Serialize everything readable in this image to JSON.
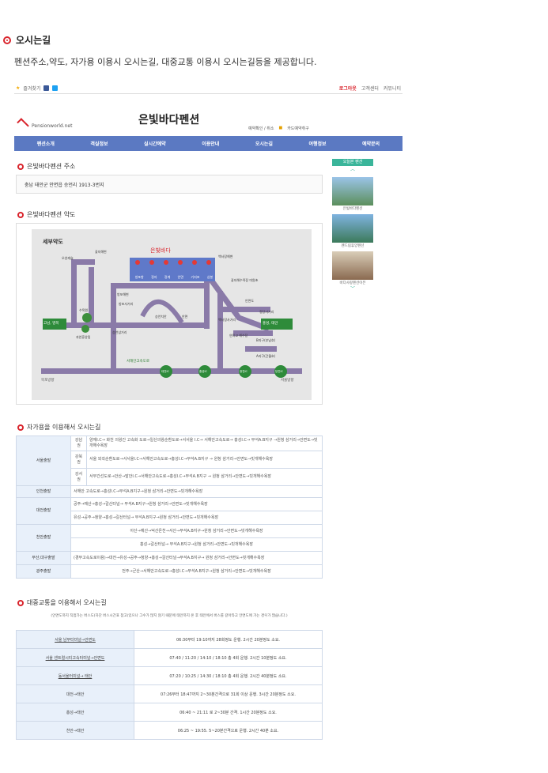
{
  "title": "오시는길",
  "desc": "펜션주소,약도, 자가용 이용시 오시는길, 대중교통 이용시 오시는길등을 제공합니다.",
  "topbar": {
    "fav": "즐겨찾기",
    "login": "로그아웃",
    "cs": "고객센터",
    "community": "커뮤니티"
  },
  "logo": "Pensionworld.net",
  "brand": "은빛바다펜션",
  "util": {
    "check": "예약확인 / 취소",
    "card": "카드예약취구"
  },
  "nav": [
    "펜션소개",
    "객실정보",
    "실시간예약",
    "이용안내",
    "오시는길",
    "여행정보",
    "예약문의"
  ],
  "sections": {
    "addr": "은빛바다펜션 주소",
    "map": "은빛바다펜션 약도",
    "car": "자가용을 이용해서 오시는길",
    "bus": "대중교통을 이용해서 오시는길"
  },
  "address": "충남 태안군 안면읍 승언리 1913-3번지",
  "map_labels": {
    "title": "세부약도",
    "pension": "은빛바다",
    "left": "고남, 영목",
    "right": "홍성, 태안",
    "highway": "서해안고속도로",
    "bottom_left": "목포방향",
    "bottom_right": "서울방향"
  },
  "map_places": [
    "오션캐슬",
    "꽃지해변",
    "방포해변",
    "백사장해변",
    "꽃지해수욕장 미원초",
    "방포사거리",
    "승언삼거리",
    "수목원",
    "자연휴양림",
    "승언치안",
    "안면도",
    "정당사거리",
    "백사장사거리",
    "연육교 해수장",
    "B지구(부남호)",
    "A지구(간월호)",
    "안면",
    "대천IC",
    "홍성IC",
    "광천IC",
    "당진IC"
  ],
  "map_rooms": [
    "방포항",
    "정자",
    "정계",
    "안면",
    "기지포",
    "삼봉"
  ],
  "side": {
    "hdr": "오늘본 펜션",
    "caps": [
      "은빛바다펜션",
      "펜드림휴양펜션",
      "바다사랑펜션이븐"
    ]
  },
  "car": [
    {
      "k": "서울출발",
      "k2": "강남권",
      "v": "양재I.C→ 화천 의왕간 고속화 도로→일산의왕순환도로→서서울 I.C→ 서해안고속도로→ 홍성I.C→ 부석A.B지구 →원청 삼거리→안면도→빗개해수욕장"
    },
    {
      "k": "",
      "k2": "강북권",
      "v": "서울 외곽순환도로→서서울I.C→서해안고속도로→홍성I.C→부석A.B지구 → 원청 삼거리→안면도→빗개해수욕장"
    },
    {
      "k": "",
      "k2": "강서권",
      "v": "서부간선도로→안산→발안I.C→서해안고속도로→홍성I.C→부석A.B지구 → 원청 삼거리→안면도→빗개해수욕장"
    },
    {
      "k": "인천출발",
      "k2": "",
      "v": "서해안 고속도로→홍성I.C→부석A.B지구→원청 삼거리→안면도→빗개해수욕장"
    },
    {
      "k": "대전출발",
      "k2": "",
      "v": "공주→예산→홍성→갈산터널→ 부석A.B지구→원청 삼거리→안면도→빗개해수욕장"
    },
    {
      "k": "",
      "k2": "",
      "v": "유성→공주→청양→홍성→갈산터널→ 부석A.B지구→원청 삼거리→안면도→빗개해수욕장"
    },
    {
      "k": "천안출발",
      "k2": "",
      "v": "아산→예산→덕산온천→서산→부석A.B지구→원청 삼거리→안면도→빗개해수욕장"
    },
    {
      "k": "",
      "k2": "",
      "v": "홍성→갈산터널→ 부석A.B지구→원청 삼거리→안면도→빗개해수욕장"
    },
    {
      "k": "부산,대구출발",
      "k2": "",
      "v": "(경부고속도로이용)→대전→유성→공주→청양→홍성→갈산터널→부석A.B지구→ 원청 삼거리→안면도→빗개해수욕장"
    },
    {
      "k": "광주출발",
      "k2": "",
      "v": "전주→군산→서해안고속도로→홍성I.C→부석A.B지구→원청 삼거리→안면도→빗개해수욕장"
    }
  ],
  "bus_note": "(안면도까지 직접가는 버스도(하단 버스시간표 참고)있으나 그수가 많지 않기 때문에 태안까지 온 후 태안에서 버스를 갈아타고 안면도에 가는 경우가 많습니다.)",
  "bus": [
    {
      "k": "서울 남부터미널→안면도",
      "v": "06:30부터 19:10까지 28회정도 운행. 2시간 20분정도 소요."
    },
    {
      "k": "서울 센트럴시티고속터미널→안면도",
      "v": "07:40 / 11:20 / 14:10 / 18:10 총 4회 운행. 2시간 10분정도 소요."
    },
    {
      "k": "동서울터미널→ 태안",
      "v": "07:20 / 10:25 / 14:30 / 18:10 총 4회 운행. 2시간 40분정도 소요."
    },
    {
      "k": "대전→태안",
      "v": "07:26부터 18:47까지 2~30분간격으로 31회 이상 운행. 3시간 20분정도 소요."
    },
    {
      "k": "홍성→태안",
      "v": "06:40 ~ 21:11 로 2~30분 간격. 1시간 20분정도 소요."
    },
    {
      "k": "천안→태안",
      "v": "06:25 ~ 19:55. 5~20분간격으로 운행. 2시간 40분 소요."
    }
  ],
  "colors": {
    "accent": "#d9242c",
    "nav": "#5b79c2",
    "side": "#3ab59a"
  }
}
